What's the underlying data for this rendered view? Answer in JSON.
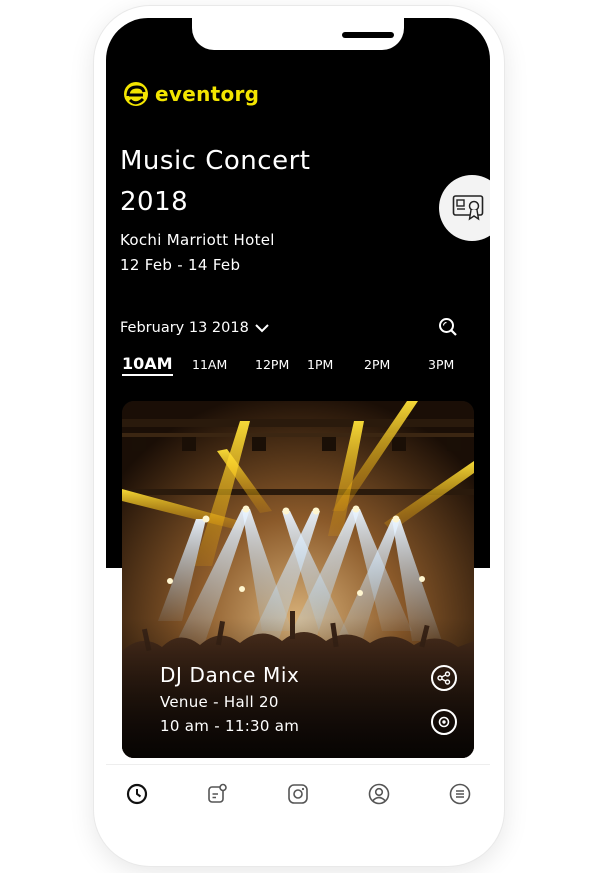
{
  "app": {
    "logo_text": "eventorg",
    "accent_color": "#f3e500"
  },
  "event": {
    "title_line1": "Music Concert",
    "title_line2": "2018",
    "venue": "Kochi Marriott Hotel",
    "dates": "12 Feb - 14 Feb"
  },
  "schedule": {
    "selected_date": "February 13 2018",
    "time_slots": [
      "10AM",
      "11AM",
      "12PM",
      "1PM",
      "2PM",
      "3PM"
    ],
    "active_slot": "10AM"
  },
  "card": {
    "title": "DJ Dance Mix",
    "venue": "Venue - Hall 20",
    "time": "10 am - 11:30 am"
  },
  "icons": {
    "badge": "certificate-icon",
    "date_dropdown": "chevron-down-icon",
    "search": "search-icon",
    "share": "share-icon",
    "target": "target-icon",
    "nav": [
      "clock-icon",
      "notes-icon",
      "instagram-icon",
      "user-icon",
      "menu-icon"
    ]
  }
}
